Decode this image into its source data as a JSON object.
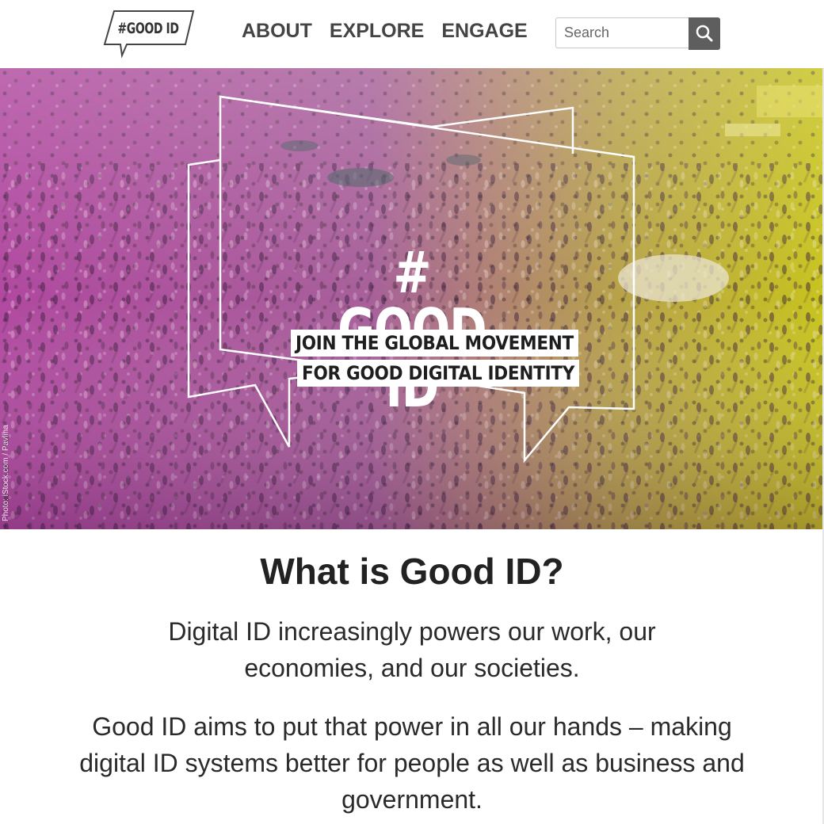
{
  "header": {
    "logo_text": "#GOOD ID",
    "nav": [
      {
        "label": "ABOUT"
      },
      {
        "label": "EXPLORE"
      },
      {
        "label": "ENGAGE"
      }
    ],
    "search": {
      "placeholder": "Search",
      "value": ""
    }
  },
  "hero": {
    "title": "# GOOD ID",
    "tagline_line1": "JOIN THE GLOBAL MOVEMENT",
    "tagline_line2": "FOR GOOD DIGITAL IDENTITY",
    "photo_credit": "Photo: iStock.com / Pavliha"
  },
  "intro": {
    "heading": "What is Good ID?",
    "paragraph1": "Digital ID increasingly powers our work, our economies, and our societies.",
    "paragraph2": "Good ID aims to put that power in all our hands – making digital ID systems better for people as well as business and government."
  },
  "colors": {
    "overlay_left": "#b43c9a",
    "overlay_right": "#c9c21a",
    "search_button": "#5e5e5e"
  },
  "icons": {
    "search_button": "search-icon",
    "logo": "speech-bubble-icon"
  }
}
